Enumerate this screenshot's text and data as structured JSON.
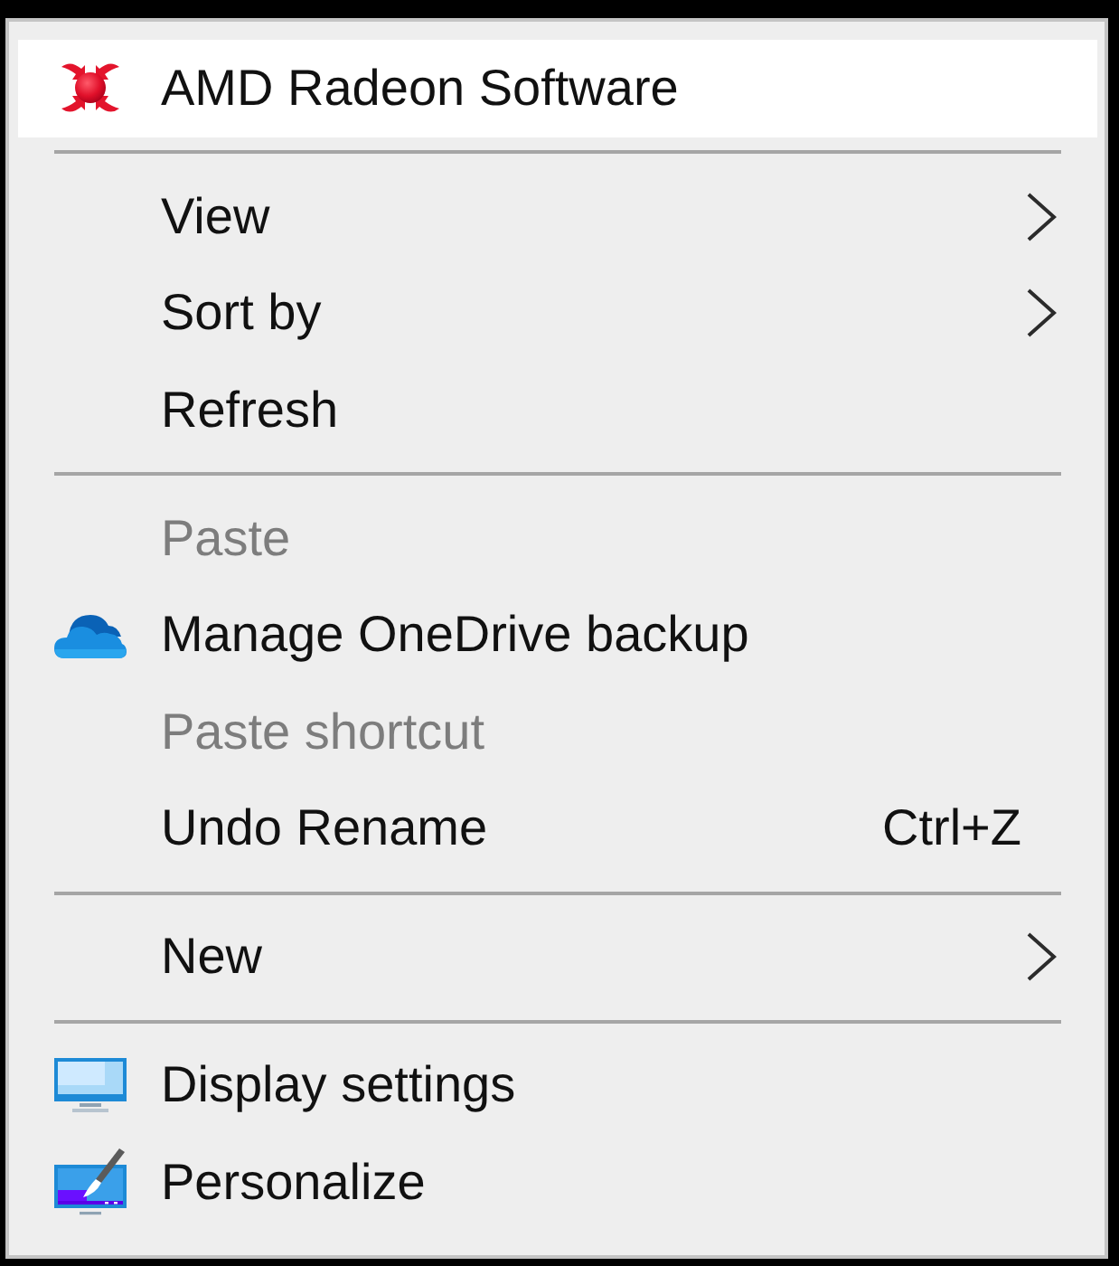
{
  "context_menu": {
    "sections": [
      {
        "items": [
          {
            "label": "AMD Radeon Software",
            "selected": true,
            "disabled": false,
            "submenu": false
          }
        ]
      },
      {
        "items": [
          {
            "label": "View",
            "selected": false,
            "disabled": false,
            "submenu": true
          },
          {
            "label": "Sort by",
            "selected": false,
            "disabled": false,
            "submenu": true
          },
          {
            "label": "Refresh",
            "selected": false,
            "disabled": false,
            "submenu": false
          }
        ]
      },
      {
        "items": [
          {
            "label": "Paste",
            "selected": false,
            "disabled": true,
            "submenu": false
          },
          {
            "label": "Manage OneDrive backup",
            "selected": false,
            "disabled": false,
            "submenu": false
          },
          {
            "label": "Paste shortcut",
            "selected": false,
            "disabled": true,
            "submenu": false
          },
          {
            "label": "Undo Rename",
            "selected": false,
            "disabled": false,
            "submenu": false,
            "shortcut": "Ctrl+Z"
          }
        ]
      },
      {
        "items": [
          {
            "label": "New",
            "selected": false,
            "disabled": false,
            "submenu": true
          }
        ]
      },
      {
        "items": [
          {
            "label": "Display settings",
            "selected": false,
            "disabled": false,
            "submenu": false
          },
          {
            "label": "Personalize",
            "selected": false,
            "disabled": false,
            "submenu": false
          }
        ]
      }
    ]
  }
}
